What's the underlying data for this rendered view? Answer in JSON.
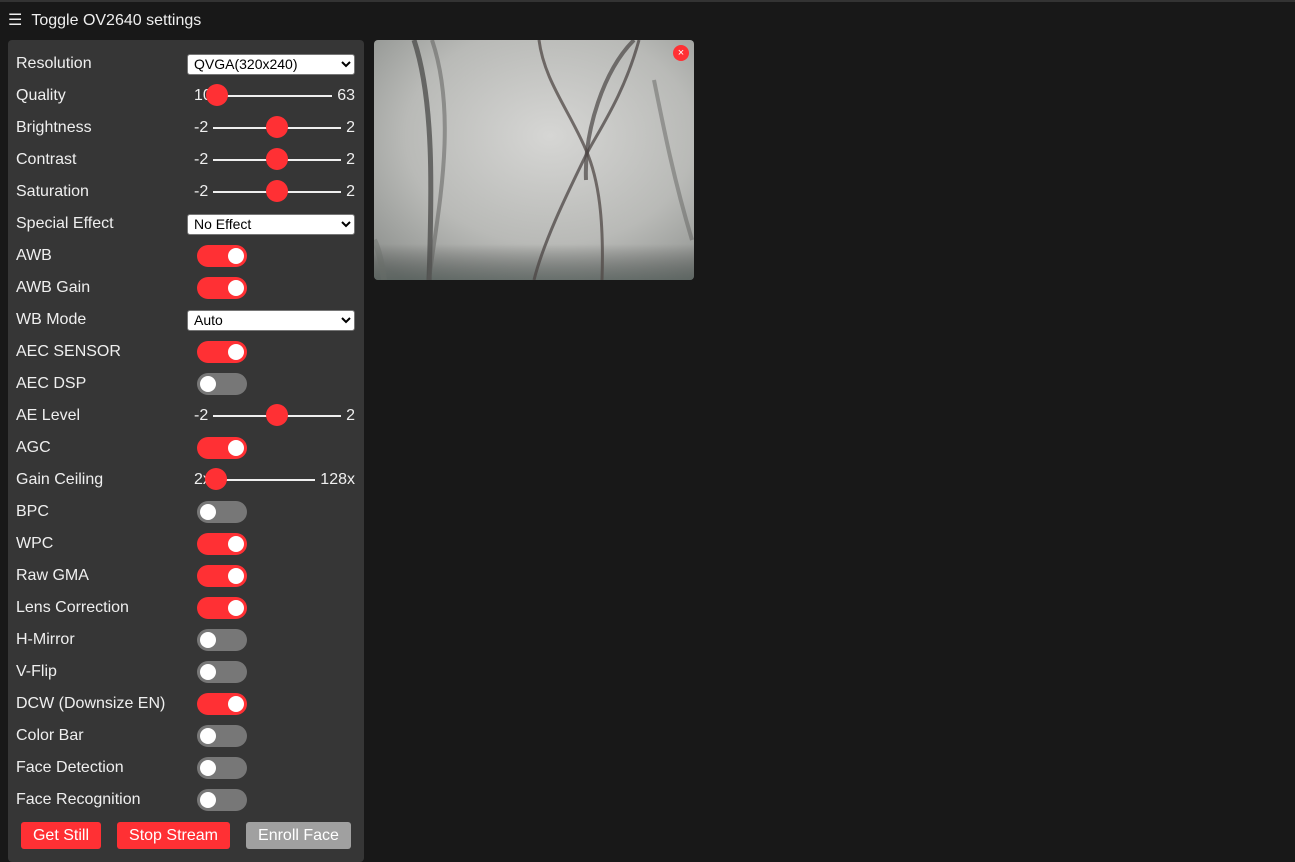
{
  "header": {
    "toggle_label": "Toggle OV2640 settings"
  },
  "settings": {
    "resolution": {
      "label": "Resolution",
      "selected": "QVGA(320x240)"
    },
    "quality": {
      "label": "Quality",
      "min": "10",
      "max": "63",
      "value": 10
    },
    "brightness": {
      "label": "Brightness",
      "min": "-2",
      "max": "2",
      "value": 0
    },
    "contrast": {
      "label": "Contrast",
      "min": "-2",
      "max": "2",
      "value": 0
    },
    "saturation": {
      "label": "Saturation",
      "min": "-2",
      "max": "2",
      "value": 0
    },
    "special_effect": {
      "label": "Special Effect",
      "selected": "No Effect"
    },
    "awb": {
      "label": "AWB",
      "on": true
    },
    "awb_gain": {
      "label": "AWB Gain",
      "on": true
    },
    "wb_mode": {
      "label": "WB Mode",
      "selected": "Auto"
    },
    "aec_sensor": {
      "label": "AEC SENSOR",
      "on": true
    },
    "aec_dsp": {
      "label": "AEC DSP",
      "on": false
    },
    "ae_level": {
      "label": "AE Level",
      "min": "-2",
      "max": "2",
      "value": 0
    },
    "agc": {
      "label": "AGC",
      "on": true
    },
    "gain_ceiling": {
      "label": "Gain Ceiling",
      "min": "2x",
      "max": "128x",
      "value": 0
    },
    "bpc": {
      "label": "BPC",
      "on": false
    },
    "wpc": {
      "label": "WPC",
      "on": true
    },
    "raw_gma": {
      "label": "Raw GMA",
      "on": true
    },
    "lens_correction": {
      "label": "Lens Correction",
      "on": true
    },
    "h_mirror": {
      "label": "H-Mirror",
      "on": false
    },
    "v_flip": {
      "label": "V-Flip",
      "on": false
    },
    "dcw": {
      "label": "DCW (Downsize EN)",
      "on": true
    },
    "color_bar": {
      "label": "Color Bar",
      "on": false
    },
    "face_detection": {
      "label": "Face Detection",
      "on": false
    },
    "face_recognition": {
      "label": "Face Recognition",
      "on": false
    }
  },
  "buttons": {
    "get_still": "Get Still",
    "stop_stream": "Stop Stream",
    "enroll_face": "Enroll Face"
  },
  "stream": {
    "close_label": "×"
  },
  "colors": {
    "accent": "#ff3034",
    "panel": "#363636",
    "background": "#181818",
    "switch_off": "#777777"
  },
  "icons": {
    "menu": "hamburger-icon",
    "close": "close-icon"
  }
}
